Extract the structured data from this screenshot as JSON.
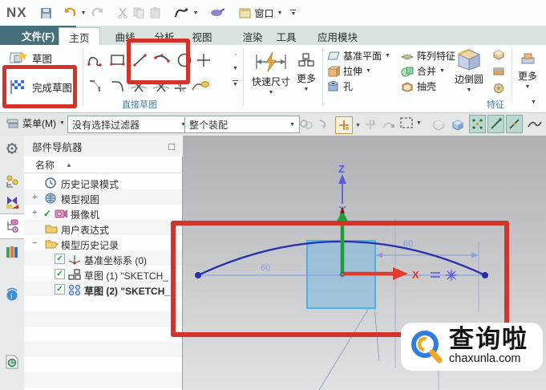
{
  "titlebar": {
    "logo": "NX",
    "window_label": "窗口"
  },
  "tabs": {
    "file": "文件(F)",
    "items": [
      "主页",
      "曲线",
      "分析",
      "视图",
      "渲染",
      "工具",
      "应用模块"
    ],
    "active": "主页"
  },
  "ribbon": {
    "sketch_label": "草图",
    "finish_sketch_label": "完成草图",
    "direct_sketch_group": "直接草图",
    "rapid_dim_label": "快速尺寸",
    "more_sketch_label": "更多",
    "datum_plane_label": "基准平面",
    "extrude_label": "拉伸",
    "hole_label": "孔",
    "pattern_label": "阵列特征",
    "unite_label": "合并",
    "shell_label": "抽壳",
    "edge_blend_label": "边倒圆",
    "more_feature_label": "更多",
    "feature_group": "特征"
  },
  "selection_bar": {
    "menu_label": "菜单(M)",
    "filter_value": "没有选择过滤器",
    "scope_value": "整个装配"
  },
  "navigator": {
    "title": "部件导航器",
    "name_column": "名称",
    "items": [
      {
        "label": "历史记录模式"
      },
      {
        "label": "模型视图"
      },
      {
        "label": "摄像机"
      },
      {
        "label": "用户表达式"
      },
      {
        "label": "模型历史记录"
      },
      {
        "label": "基准坐标系 (0)"
      },
      {
        "label": "草图 (1) \"SKETCH_"
      },
      {
        "label": "草图 (2) \"SKETCH_"
      }
    ]
  },
  "viewport": {
    "z_axis": "Z",
    "x_axis": "X",
    "dim_left": "60",
    "dim_right": "60"
  },
  "watermark": {
    "title": "查询啦",
    "domain": "chaxunla.com"
  },
  "glyphs": {
    "dropdown": "▼",
    "sort_up": "▲",
    "plus": "+",
    "minus": "−",
    "dot": "·",
    "check": "✓",
    "pin_box": "□"
  },
  "colors": {
    "annotation_red": "#d2342c",
    "file_tab_teal": "#45707b"
  }
}
